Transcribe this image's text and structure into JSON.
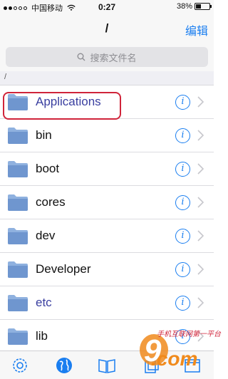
{
  "status_bar": {
    "carrier": "中国移动",
    "time": "0:27",
    "battery_text": "38%",
    "battery_level": 0.38
  },
  "nav": {
    "title": "/",
    "edit_label": "编辑"
  },
  "search": {
    "placeholder": "搜索文件名"
  },
  "path_header": "/",
  "files": [
    {
      "name": "Applications"
    },
    {
      "name": "bin"
    },
    {
      "name": "boot"
    },
    {
      "name": "cores"
    },
    {
      "name": "dev"
    },
    {
      "name": "Developer"
    },
    {
      "name": "etc"
    },
    {
      "name": "lib"
    }
  ],
  "info_glyph": "i",
  "tabs": [
    "settings-icon",
    "globe-icon",
    "book-icon",
    "copy-icon",
    "window-icon"
  ],
  "watermark": {
    "text": "手机互联网第一平台",
    "brand": ".com",
    "number": "9"
  },
  "colors": {
    "accent": "#1a7ef0",
    "highlight_border": "#d0243a",
    "folder": "#7fa3d6"
  }
}
